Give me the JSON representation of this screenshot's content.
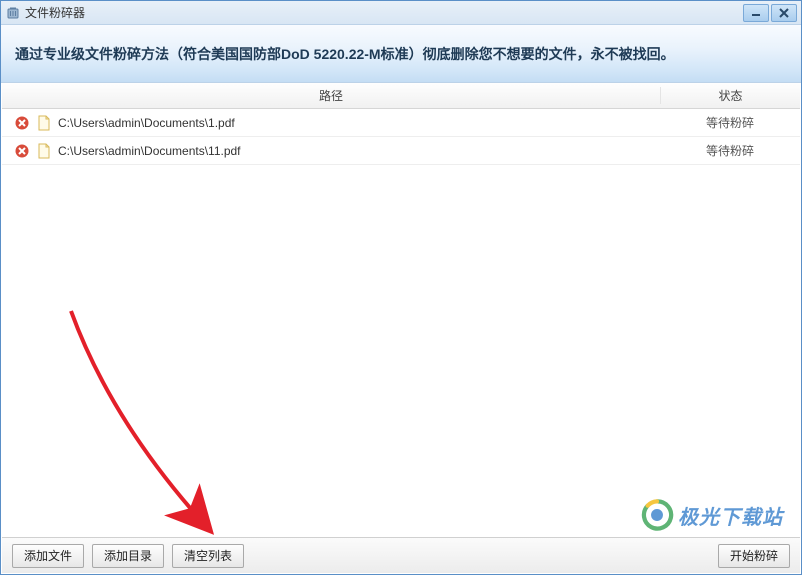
{
  "window": {
    "title": "文件粉碎器"
  },
  "banner": {
    "text": "通过专业级文件粉碎方法（符合美国国防部DoD 5220.22-M标准）彻底删除您不想要的文件，永不被找回。"
  },
  "columns": {
    "path": "路径",
    "status": "状态"
  },
  "files": [
    {
      "path": "C:\\Users\\admin\\Documents\\1.pdf",
      "status": "等待粉碎"
    },
    {
      "path": "C:\\Users\\admin\\Documents\\11.pdf",
      "status": "等待粉碎"
    }
  ],
  "buttons": {
    "add_file": "添加文件",
    "add_folder": "添加目录",
    "clear_list": "清空列表",
    "start": "开始粉碎"
  },
  "watermark": {
    "text": "极光下载站"
  }
}
